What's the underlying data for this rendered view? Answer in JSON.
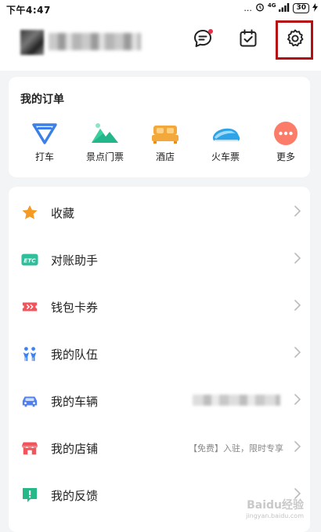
{
  "status_bar": {
    "time": "下午4:47",
    "dots": "...",
    "signal": "4G",
    "battery": "30"
  },
  "header": {
    "icons": [
      "message-icon",
      "task-check-icon",
      "settings-gear-icon"
    ],
    "highlight_color": "#b50f12",
    "notification_color": "#e8304a"
  },
  "orders": {
    "title": "我的订单",
    "items": [
      {
        "label": "打车",
        "icon": "taxi-icon"
      },
      {
        "label": "景点门票",
        "icon": "scenic-ticket-icon"
      },
      {
        "label": "酒店",
        "icon": "hotel-icon"
      },
      {
        "label": "火车票",
        "icon": "train-ticket-icon"
      },
      {
        "label": "更多",
        "icon": "more-icon"
      }
    ]
  },
  "menu": {
    "items": [
      {
        "label": "收藏",
        "icon": "star-icon",
        "extra": ""
      },
      {
        "label": "对账助手",
        "icon": "etc-icon",
        "extra": "",
        "icon_text": "ETC"
      },
      {
        "label": "钱包卡券",
        "icon": "coupon-icon",
        "extra": ""
      },
      {
        "label": "我的队伍",
        "icon": "team-icon",
        "extra": ""
      },
      {
        "label": "我的车辆",
        "icon": "car-icon",
        "extra": ""
      },
      {
        "label": "我的店铺",
        "icon": "shop-icon",
        "extra": "【免费】入驻，限时专享"
      },
      {
        "label": "我的反馈",
        "icon": "feedback-icon",
        "extra": ""
      }
    ]
  },
  "watermark": {
    "text": "Baidu经验",
    "url": "jingyan.baidu.com"
  }
}
